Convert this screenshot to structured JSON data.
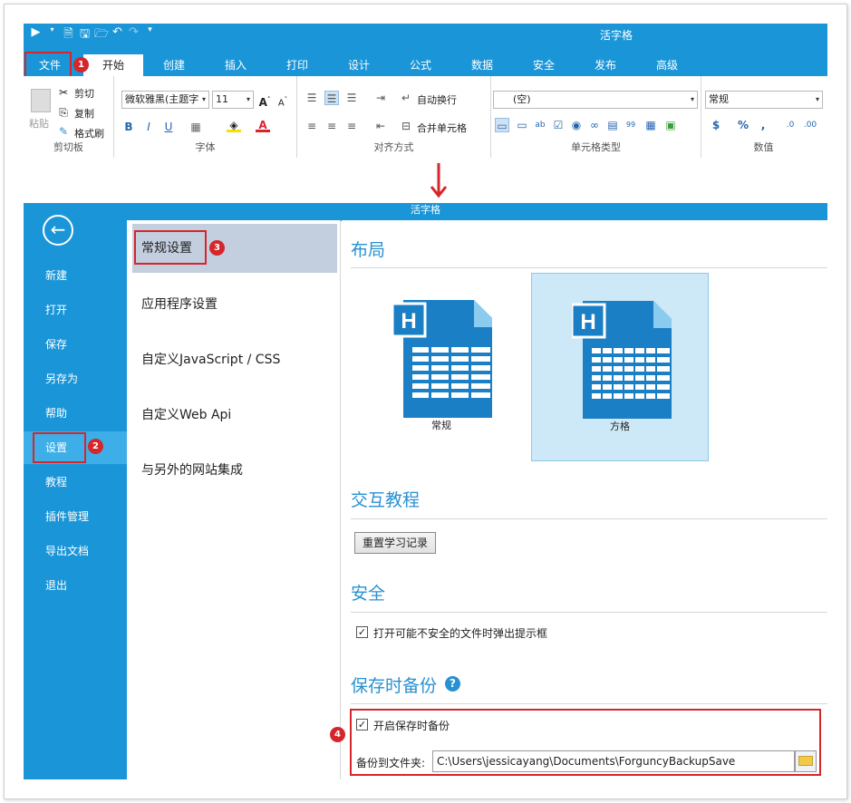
{
  "top_window": {
    "title": "活字格",
    "tabs": [
      "文件",
      "开始",
      "创建",
      "插入",
      "打印",
      "设计",
      "公式",
      "数据",
      "安全",
      "发布",
      "高级"
    ]
  },
  "ribbon": {
    "clipboard": {
      "paste": "粘贴",
      "cut": "剪切",
      "copy": "复制",
      "format_painter": "格式刷",
      "group": "剪切板"
    },
    "font": {
      "family": "微软雅黑(主题字",
      "size": "11",
      "group": "字体",
      "bold": "B",
      "italic": "I",
      "underline": "U"
    },
    "alignment": {
      "wrap": "自动换行",
      "merge": "合并单元格",
      "group": "对齐方式"
    },
    "cell_type": {
      "value": "(空)",
      "group": "单元格类型"
    },
    "number": {
      "format": "常规",
      "group": "数值",
      "currency": "$",
      "percent": "%",
      "comma": ","
    }
  },
  "bottom_window": {
    "title": "活字格"
  },
  "left_nav": [
    "新建",
    "打开",
    "保存",
    "另存为",
    "帮助",
    "设置",
    "教程",
    "插件管理",
    "导出文档",
    "退出"
  ],
  "settings_nav": [
    "常规设置",
    "应用程序设置",
    "自定义JavaScript / CSS",
    "自定义Web Api",
    "与另外的网站集成"
  ],
  "content": {
    "layout": {
      "title": "布局",
      "option1": "常规",
      "option2": "方格"
    },
    "tutorial": {
      "title": "交互教程",
      "reset_button": "重置学习记录"
    },
    "security": {
      "title": "安全",
      "checkbox_label": "打开可能不安全的文件时弹出提示框"
    },
    "backup": {
      "title": "保存时备份",
      "help": "?",
      "checkbox_label": "开启保存时备份",
      "folder_label": "备份到文件夹:",
      "folder_path": "C:\\Users\\jessicayang\\Documents\\ForguncyBackupSave"
    }
  },
  "badges": [
    "1",
    "2",
    "3",
    "4"
  ],
  "colors": {
    "accent": "#1a96d8",
    "highlight": "#d5262b",
    "section_title": "#2891d2"
  }
}
